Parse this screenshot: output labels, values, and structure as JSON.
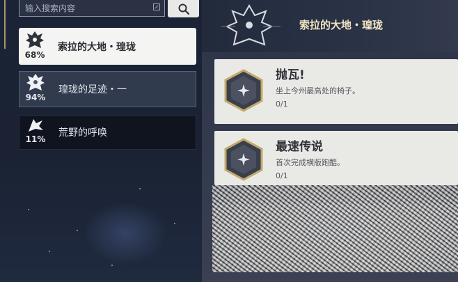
{
  "search": {
    "placeholder": "输入搜索内容"
  },
  "categories": [
    {
      "name": "索拉的大地・瑝珑",
      "percent": "68%"
    },
    {
      "name": "瑝珑的足迹・一",
      "percent": "94%"
    },
    {
      "name": "荒野的呼唤",
      "percent": "11%"
    }
  ],
  "header": {
    "title": "索拉的大地・瑝珑"
  },
  "achievements": [
    {
      "title": "抛瓦!",
      "description": "坐上今州最高处的椅子。",
      "progress": "0/1"
    },
    {
      "title": "最速传说",
      "description": "首次完成横版跑酷。",
      "progress": "0/1"
    }
  ],
  "icons": {
    "edit": "edit-icon",
    "search": "search-icon",
    "achievement": "sparkle-icon"
  }
}
